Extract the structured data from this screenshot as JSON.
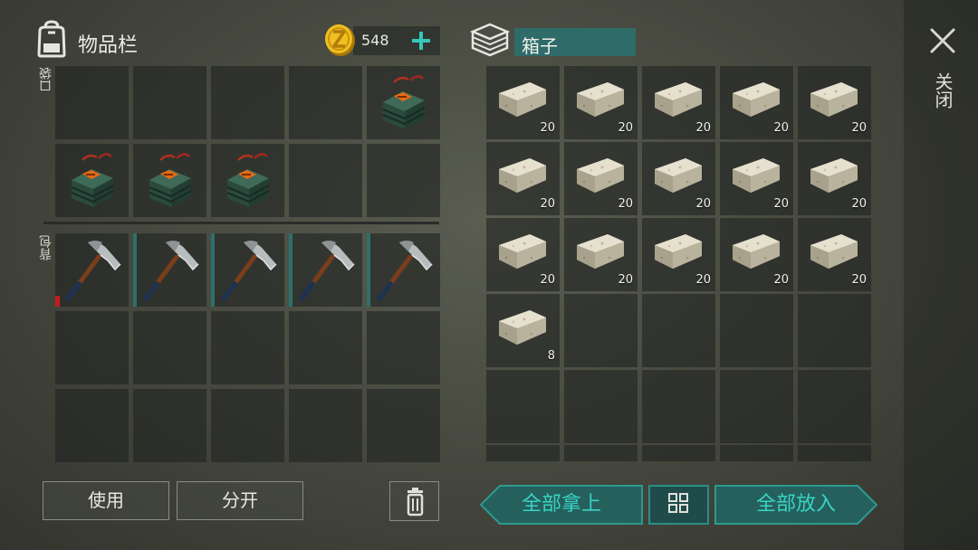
{
  "inventory": {
    "title": "物品栏",
    "pocket_label": "口袋",
    "backpack_label": "背包",
    "coins": "548",
    "pocket_slots": [
      {
        "item": "",
        "qty": ""
      },
      {
        "item": "",
        "qty": ""
      },
      {
        "item": "",
        "qty": ""
      },
      {
        "item": "",
        "qty": ""
      },
      {
        "item": "explosive-bundle",
        "qty": ""
      },
      {
        "item": "explosive-bundle",
        "qty": ""
      },
      {
        "item": "explosive-bundle",
        "qty": ""
      },
      {
        "item": "explosive-bundle",
        "qty": ""
      },
      {
        "item": "",
        "qty": ""
      },
      {
        "item": "",
        "qty": ""
      }
    ],
    "backpack_slots": [
      {
        "item": "pickaxe",
        "qty": "",
        "durability_low": true
      },
      {
        "item": "pickaxe",
        "qty": ""
      },
      {
        "item": "pickaxe",
        "qty": ""
      },
      {
        "item": "pickaxe",
        "qty": ""
      },
      {
        "item": "pickaxe",
        "qty": ""
      },
      {
        "item": "",
        "qty": ""
      },
      {
        "item": "",
        "qty": ""
      },
      {
        "item": "",
        "qty": ""
      },
      {
        "item": "",
        "qty": ""
      },
      {
        "item": "",
        "qty": ""
      },
      {
        "item": "",
        "qty": ""
      },
      {
        "item": "",
        "qty": ""
      },
      {
        "item": "",
        "qty": ""
      },
      {
        "item": "",
        "qty": ""
      },
      {
        "item": "",
        "qty": ""
      }
    ],
    "use_label": "使用",
    "split_label": "分开"
  },
  "box": {
    "title": "箱子",
    "slots": [
      {
        "item": "stone-block",
        "qty": "20"
      },
      {
        "item": "stone-block",
        "qty": "20"
      },
      {
        "item": "stone-block",
        "qty": "20"
      },
      {
        "item": "stone-block",
        "qty": "20"
      },
      {
        "item": "stone-block",
        "qty": "20"
      },
      {
        "item": "stone-block",
        "qty": "20"
      },
      {
        "item": "stone-block",
        "qty": "20"
      },
      {
        "item": "stone-block",
        "qty": "20"
      },
      {
        "item": "stone-block",
        "qty": "20"
      },
      {
        "item": "stone-block",
        "qty": "20"
      },
      {
        "item": "stone-block",
        "qty": "20"
      },
      {
        "item": "stone-block",
        "qty": "20"
      },
      {
        "item": "stone-block",
        "qty": "20"
      },
      {
        "item": "stone-block",
        "qty": "20"
      },
      {
        "item": "stone-block",
        "qty": "20"
      },
      {
        "item": "stone-block",
        "qty": "8"
      },
      {
        "item": "",
        "qty": ""
      },
      {
        "item": "",
        "qty": ""
      },
      {
        "item": "",
        "qty": ""
      },
      {
        "item": "",
        "qty": ""
      },
      {
        "item": "",
        "qty": ""
      },
      {
        "item": "",
        "qty": ""
      },
      {
        "item": "",
        "qty": ""
      },
      {
        "item": "",
        "qty": ""
      },
      {
        "item": "",
        "qty": ""
      }
    ],
    "take_all_label": "全部拿上",
    "put_all_label": "全部放入"
  },
  "close_label": "关闭",
  "colors": {
    "accent": "#39d3c5",
    "slot": "#1c1f1e",
    "teal_dark": "#2e6b69",
    "durability_low": "#c41c1c"
  }
}
